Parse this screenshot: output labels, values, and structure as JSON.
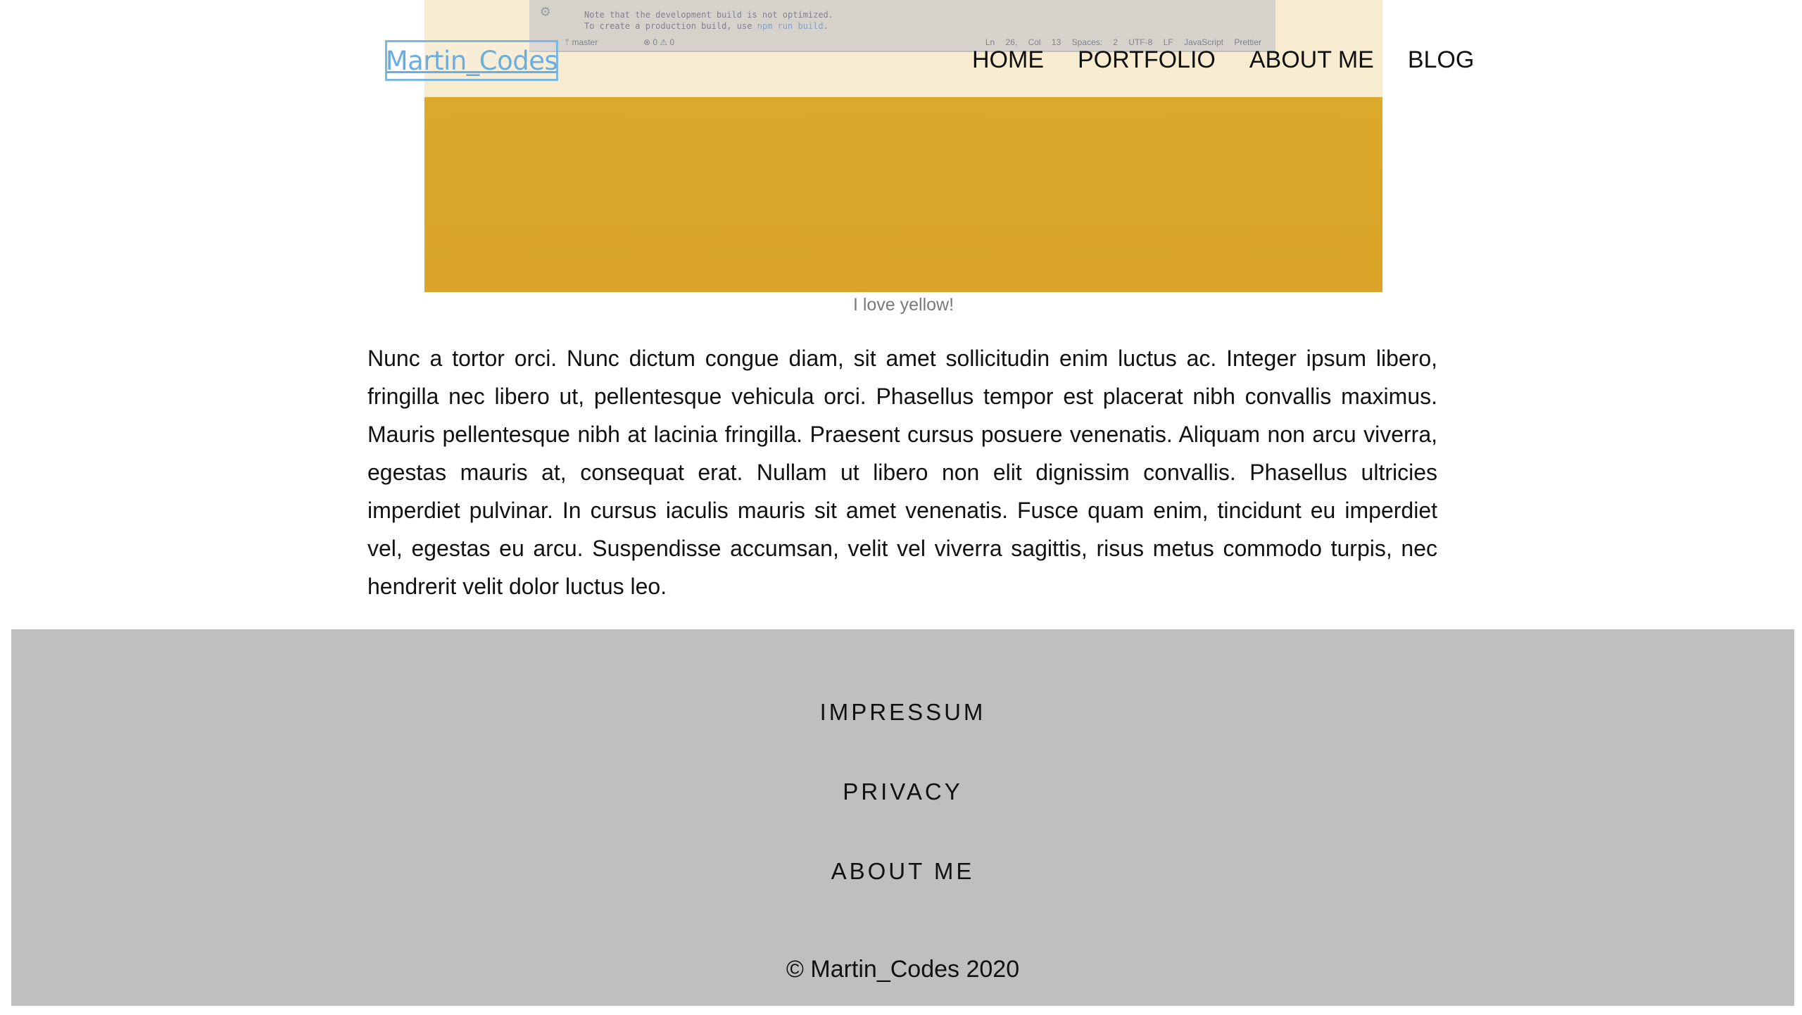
{
  "header": {
    "brand": "Martin_Codes",
    "nav": [
      {
        "label": "HOME"
      },
      {
        "label": "PORTFOLIO"
      },
      {
        "label": "ABOUT ME"
      },
      {
        "label": "BLOG"
      }
    ]
  },
  "hero": {
    "editor_line_1": "Note that the development build is not optimized.",
    "editor_line_2_prefix": "To create a production build, use ",
    "editor_line_2_cmd": "npm run build",
    "editor_line_2_suffix": ".",
    "status_branch": "master",
    "status_errors": "⊗ 0 ⚠ 0",
    "status_right": "Ln 26, Col 13  Spaces: 2  UTF-8  LF  JavaScript  Prettier",
    "caption": "I love yellow!"
  },
  "article": {
    "paragraph": "Nunc a tortor orci. Nunc dictum congue diam, sit amet sollicitudin enim luctus ac. Integer ipsum libero, fringilla nec libero ut, pellentesque vehicula orci. Phasellus tempor est placerat nibh convallis maximus. Mauris pellentesque nibh at lacinia fringilla. Praesent cursus posuere venenatis. Aliquam non arcu viverra, egestas mauris at, consequat erat. Nullam ut libero non elit dignissim convallis. Phasellus ultricies imperdiet pulvinar. In cursus iaculis mauris sit amet venenatis. Fusce quam enim, tincidunt eu imperdiet vel, egestas eu arcu. Suspendisse accumsan, velit vel viverra sagittis, risus metus commodo turpis, nec hendrerit velit dolor luctus leo."
  },
  "footer": {
    "links": [
      {
        "label": "IMPRESSUM"
      },
      {
        "label": "PRIVACY"
      },
      {
        "label": "ABOUT ME"
      }
    ],
    "copyright": "© Martin_Codes 2020"
  },
  "colors": {
    "brand_blue": "#6aaee0",
    "hero_yellow": "#dba62a",
    "footer_gray": "#bfbfbf"
  }
}
